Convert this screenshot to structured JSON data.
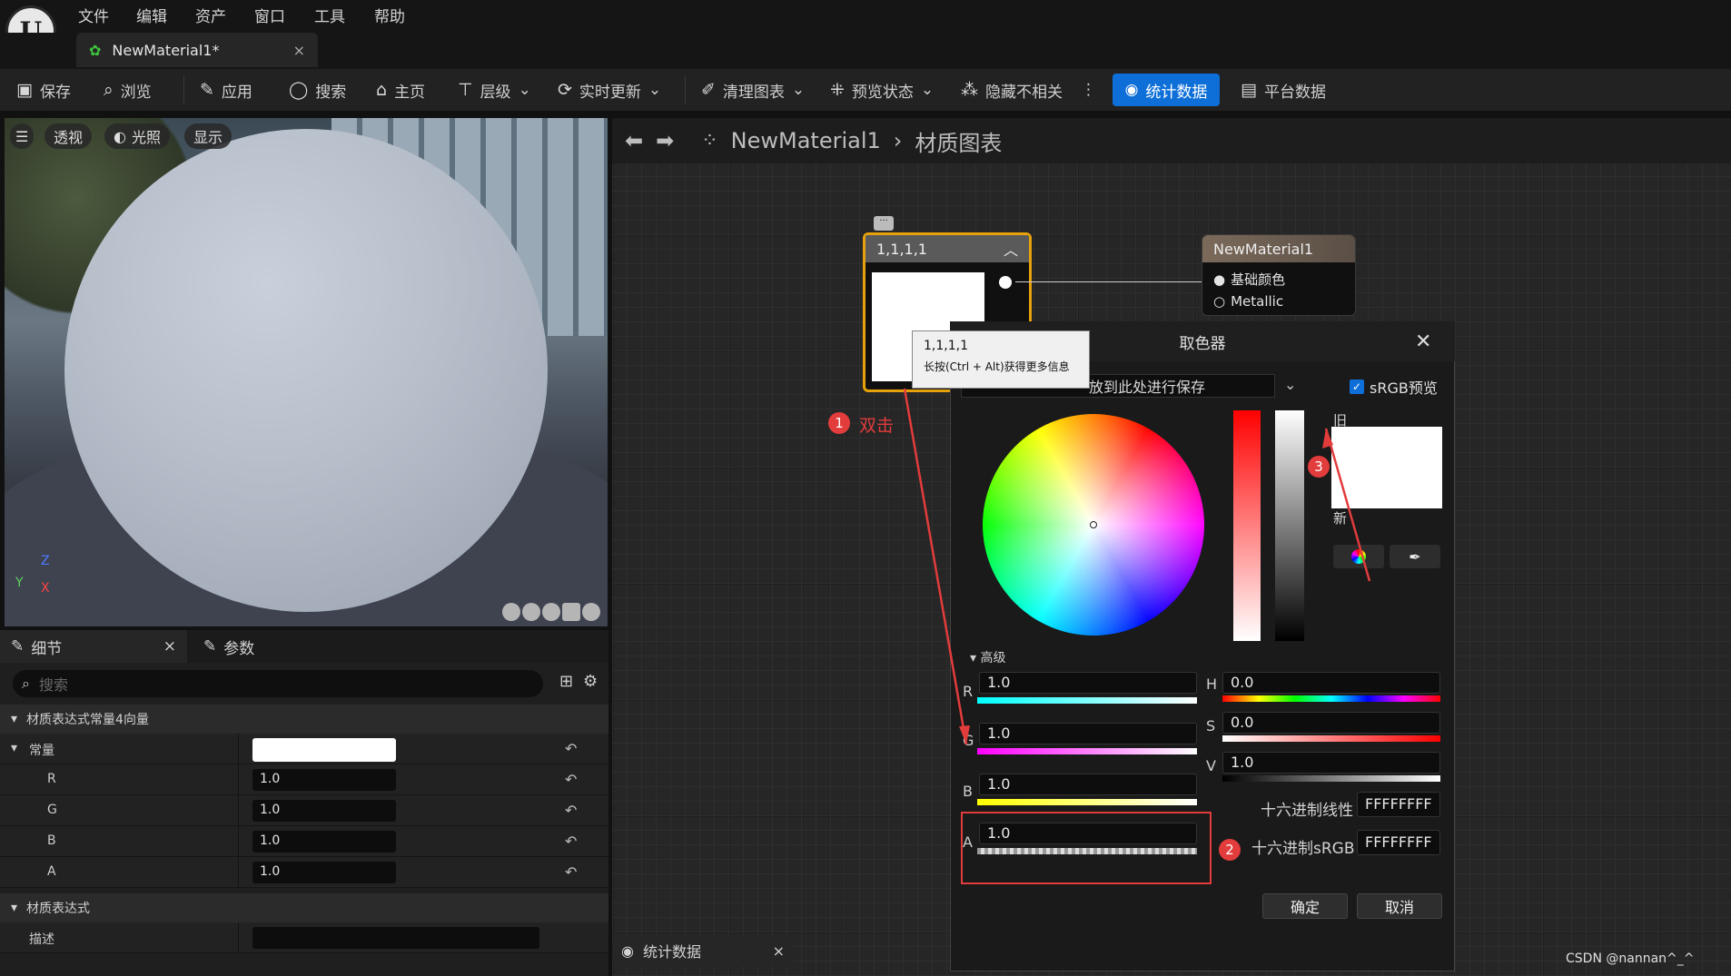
{
  "menu": [
    "文件",
    "编辑",
    "资产",
    "窗口",
    "工具",
    "帮助"
  ],
  "doc_tab": {
    "title": "NewMaterial1*",
    "close": "×"
  },
  "toolbar": {
    "save": "保存",
    "browse": "浏览",
    "apply": "应用",
    "search": "搜索",
    "home": "主页",
    "hierarchy": "层级",
    "live_update": "实时更新",
    "clean_graph": "清理图表",
    "preview_state": "预览状态",
    "hide_unrelated": "隐藏不相关",
    "stats": "统计数据",
    "platform_stats": "平台数据"
  },
  "viewport": {
    "perspective": "透视",
    "lighting": "光照",
    "show": "显示",
    "axis_z": "Z",
    "axis_y": "Y",
    "axis_x": "X"
  },
  "details": {
    "tab_details": "细节",
    "tab_params": "参数",
    "close": "×",
    "search_placeholder": "搜索",
    "section_vector": "材质表达式常量4向量",
    "constant_label": "常量",
    "rows": [
      {
        "label": "R",
        "value": "1.0"
      },
      {
        "label": "G",
        "value": "1.0"
      },
      {
        "label": "B",
        "value": "1.0"
      },
      {
        "label": "A",
        "value": "1.0"
      }
    ],
    "section_expr": "材质表达式",
    "desc_label": "描述",
    "desc_value": ""
  },
  "graph": {
    "breadcrumb_asset": "NewMaterial1",
    "breadcrumb_page": "材质图表"
  },
  "const_node": {
    "title": "1,1,1,1",
    "swatch_color": "#ffffff"
  },
  "mat_node": {
    "title": "NewMaterial1",
    "pin1": "基础颜色",
    "pin2": "Metallic"
  },
  "tooltip": {
    "title": "1,1,1,1",
    "hint": "长按(Ctrl + Alt)获得更多信息"
  },
  "annotations": {
    "n1": "1",
    "n1_text": "双击",
    "n2": "2",
    "n3": "3"
  },
  "picker": {
    "title": "取色器",
    "theme_text": "放到此处进行保存",
    "srgb_label": "sRGB预览",
    "srgb_checked": true,
    "old_label": "旧",
    "new_label": "新",
    "advanced": "高级",
    "R": "1.0",
    "G": "1.0",
    "B": "1.0",
    "A": "1.0",
    "H": "0.0",
    "S": "0.0",
    "V": "1.0",
    "hex_linear_label": "十六进制线性",
    "hex_linear": "FFFFFFFF",
    "hex_srgb_label": "十六进制sRGB",
    "hex_srgb": "FFFFFFFF",
    "ok": "确定",
    "cancel": "取消"
  },
  "stats_tab": {
    "label": "统计数据",
    "close": "×"
  },
  "watermark": "CSDN @nannan^_^",
  "colors": {
    "accent": "#0e6fd8",
    "node_selected": "#e7a20b",
    "annotation": "#e23c3c"
  }
}
